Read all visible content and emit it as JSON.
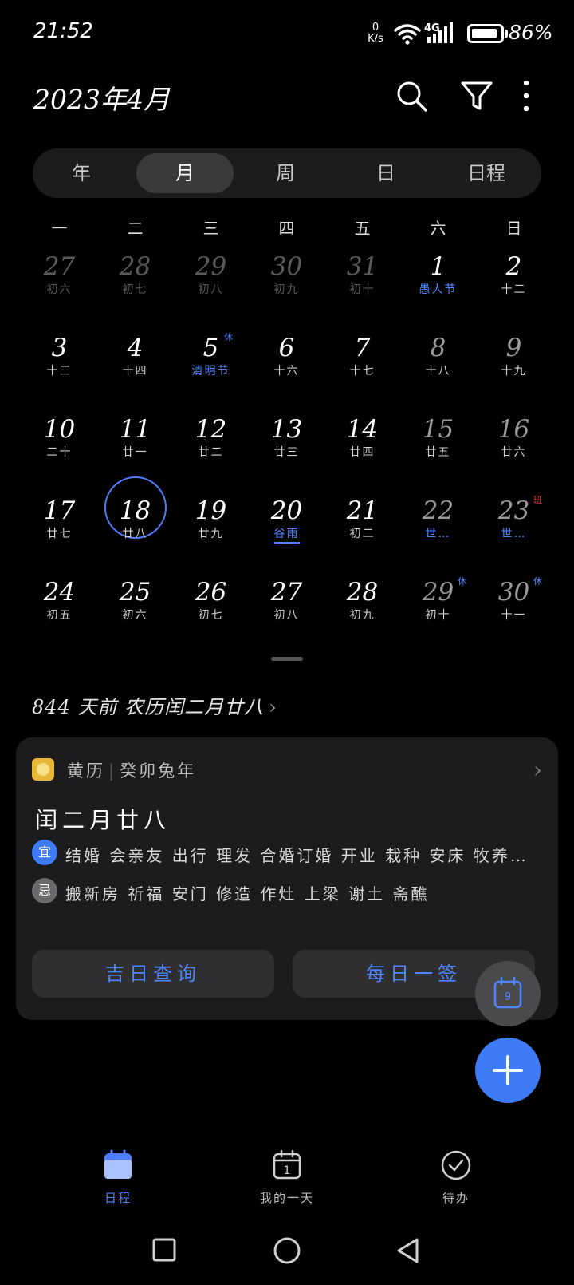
{
  "status": {
    "time": "21:52",
    "net_speed_value": "0",
    "net_speed_unit": "K/s",
    "network": "4G",
    "battery": "86%",
    "battery_level": 0.86
  },
  "header": {
    "title": "2023年4月"
  },
  "view_tabs": [
    {
      "label": "年",
      "active": false
    },
    {
      "label": "月",
      "active": true
    },
    {
      "label": "周",
      "active": false
    },
    {
      "label": "日",
      "active": false
    },
    {
      "label": "日程",
      "active": false
    }
  ],
  "weekdays": [
    "一",
    "二",
    "三",
    "四",
    "五",
    "六",
    "日"
  ],
  "weeks": [
    [
      {
        "day": "27",
        "lunar": "初六",
        "dim": true
      },
      {
        "day": "28",
        "lunar": "初七",
        "dim": true
      },
      {
        "day": "29",
        "lunar": "初八",
        "dim": true
      },
      {
        "day": "30",
        "lunar": "初九",
        "dim": true
      },
      {
        "day": "31",
        "lunar": "初十",
        "dim": true
      },
      {
        "day": "1",
        "lunar": "愚人节",
        "type": "festival"
      },
      {
        "day": "2",
        "lunar": "十二"
      }
    ],
    [
      {
        "day": "3",
        "lunar": "十三"
      },
      {
        "day": "4",
        "lunar": "十四"
      },
      {
        "day": "5",
        "lunar": "清明节",
        "type": "festival",
        "badge": "休"
      },
      {
        "day": "6",
        "lunar": "十六"
      },
      {
        "day": "7",
        "lunar": "十七"
      },
      {
        "day": "8",
        "lunar": "十八",
        "weekend": true
      },
      {
        "day": "9",
        "lunar": "十九",
        "weekend": true
      }
    ],
    [
      {
        "day": "10",
        "lunar": "二十"
      },
      {
        "day": "11",
        "lunar": "廿一"
      },
      {
        "day": "12",
        "lunar": "廿二"
      },
      {
        "day": "13",
        "lunar": "廿三"
      },
      {
        "day": "14",
        "lunar": "廿四"
      },
      {
        "day": "15",
        "lunar": "廿五",
        "weekend": true
      },
      {
        "day": "16",
        "lunar": "廿六",
        "weekend": true
      }
    ],
    [
      {
        "day": "17",
        "lunar": "廿七"
      },
      {
        "day": "18",
        "lunar": "廿八",
        "today": true
      },
      {
        "day": "19",
        "lunar": "廿九"
      },
      {
        "day": "20",
        "lunar": "谷雨",
        "type": "solar_term"
      },
      {
        "day": "21",
        "lunar": "初二"
      },
      {
        "day": "22",
        "lunar": "世…",
        "type": "festival",
        "weekend": true
      },
      {
        "day": "23",
        "lunar": "世…",
        "type": "festival",
        "weekend": true,
        "badge": "班",
        "badge_work": true
      }
    ],
    [
      {
        "day": "24",
        "lunar": "初五"
      },
      {
        "day": "25",
        "lunar": "初六"
      },
      {
        "day": "26",
        "lunar": "初七"
      },
      {
        "day": "27",
        "lunar": "初八"
      },
      {
        "day": "28",
        "lunar": "初九"
      },
      {
        "day": "29",
        "lunar": "初十",
        "weekend": true,
        "badge": "休"
      },
      {
        "day": "30",
        "lunar": "十一",
        "weekend": true,
        "badge": "休"
      }
    ]
  ],
  "days_ago": "844 天前 农历闰二月廿八",
  "almanac": {
    "source": "黄历",
    "year": "癸卯兔年",
    "lunar_date": "闰二月廿八",
    "yi_tag": "宜",
    "yi": "结婚 会亲友 出行 理发 合婚订婚 开业 栽种 安床 牧养…",
    "ji_tag": "忌",
    "ji": "搬新房 祈福 安门 修造 作灶 上梁 谢土 斋醮",
    "btn_lucky": "吉日查询",
    "btn_daily": "每日一签"
  },
  "fab_small_number": "9",
  "bottom_tabs": [
    {
      "label": "日程",
      "icon": "calendar-icon",
      "active": true
    },
    {
      "label": "我的一天",
      "icon": "day-calendar-icon",
      "active": false
    },
    {
      "label": "待办",
      "icon": "check-circle-icon",
      "active": false
    }
  ],
  "colors": {
    "accent": "#4f86ff",
    "background": "#000000",
    "card": "#1c1c1e",
    "work_badge": "#e53935"
  },
  "icons": [
    "search-icon",
    "filter-icon",
    "more-icon",
    "wifi-icon",
    "signal-icon",
    "battery-icon",
    "plus-icon",
    "square-nav-icon",
    "circle-nav-icon",
    "back-nav-icon"
  ]
}
